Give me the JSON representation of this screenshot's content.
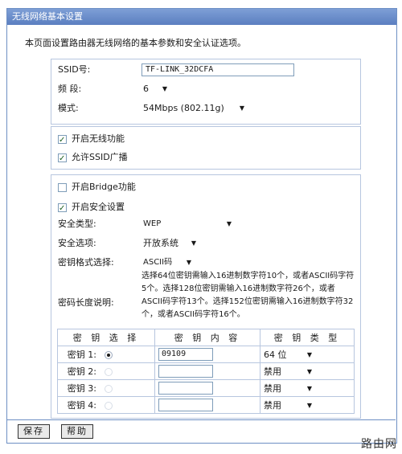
{
  "window": {
    "title": "无线网络基本设置"
  },
  "intro": "本页面设置路由器无线网络的基本参数和安全认证选项。",
  "basic": {
    "ssid_label": "SSID号:",
    "ssid_value": "TF-LINK_32DCFA",
    "band_label": "频 段:",
    "band_value": "6",
    "mode_label": "模式:",
    "mode_value": "54Mbps (802.11g)"
  },
  "toggles": {
    "wireless_label": "开启无线功能",
    "ssid_broadcast_label": "允许SSID广播"
  },
  "bridge": {
    "label": "开启Bridge功能"
  },
  "security": {
    "enable_label": "开启安全设置",
    "type_label": "安全类型:",
    "type_value": "WEP",
    "option_label": "安全选项:",
    "option_value": "开放系统",
    "format_label": "密钥格式选择:",
    "format_value": "ASCII码",
    "length_label": "密码长度说明:",
    "length_desc": "选择64位密钥需输入16进制数字符10个，或者ASCII码字符5个。选择128位密钥需输入16进制数字符26个，或者ASCII码字符13个。选择152位密钥需输入16进制数字符32个，或者ASCII码字符16个。"
  },
  "keys": {
    "headers": [
      "密 钥 选 择",
      "密 钥 内 容",
      "密 钥 类 型"
    ],
    "rows": [
      {
        "label": "密钥 1:",
        "value": "09109",
        "type": "64 位"
      },
      {
        "label": "密钥 2:",
        "value": "",
        "type": "禁用"
      },
      {
        "label": "密钥 3:",
        "value": "",
        "type": "禁用"
      },
      {
        "label": "密钥 4:",
        "value": "",
        "type": "禁用"
      }
    ]
  },
  "buttons": {
    "save": "保存",
    "help": "帮助"
  },
  "watermark": "路由网",
  "icons": {
    "checkbox_checked": "checkmark-icon",
    "dropdown": "chevron-down-icon",
    "radio": "radio-icon"
  }
}
